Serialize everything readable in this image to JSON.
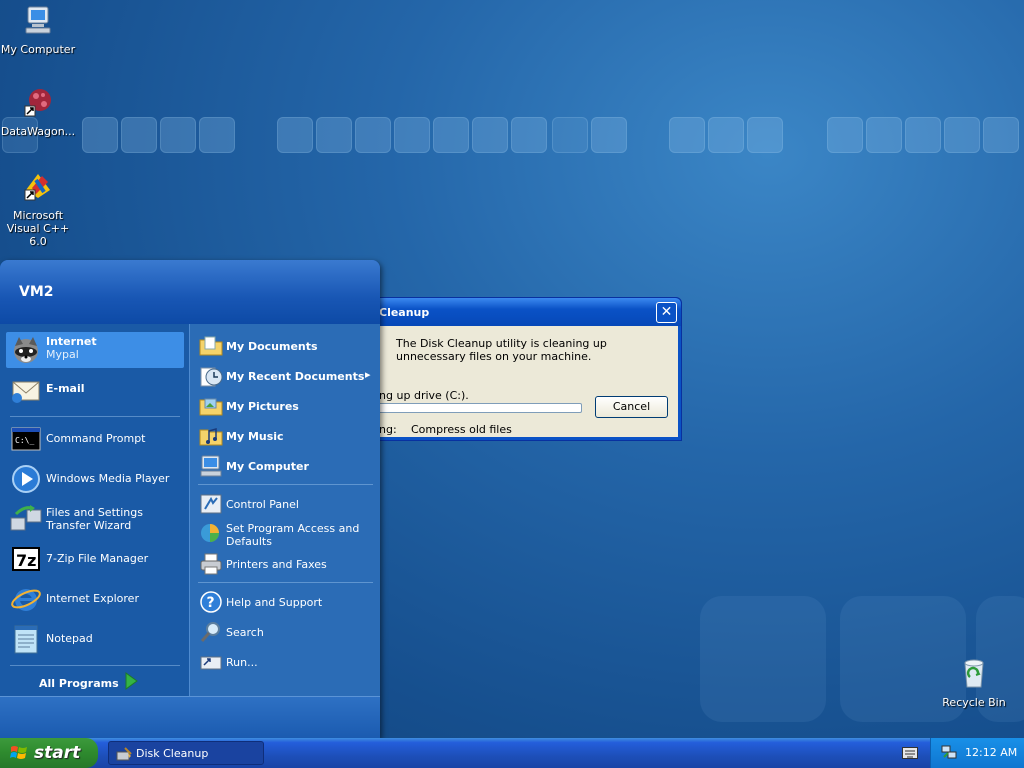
{
  "desktop": {
    "icons": [
      {
        "label": "My Computer"
      },
      {
        "label": "DataWagon..."
      },
      {
        "label": "Microsoft Visual C++ 6.0"
      },
      {
        "label": "Recycle Bin"
      }
    ]
  },
  "dialog": {
    "title": "Cleanup",
    "message": "The Disk Cleanup utility is cleaning up unnecessary files on your machine.",
    "drive_label": "ing up drive  (C:).",
    "progress": 0,
    "current_label": "ing:",
    "current_value": "Compress old files",
    "cancel_label": "Cancel",
    "close_glyph": "✕"
  },
  "start_menu": {
    "user": "VM2",
    "pinned": [
      {
        "label": "Internet",
        "sub": "Mypal"
      },
      {
        "label": "E-mail"
      }
    ],
    "recent": [
      {
        "label": "Command Prompt"
      },
      {
        "label": "Windows Media Player"
      },
      {
        "label": "Files and Settings Transfer Wizard"
      },
      {
        "label": "7-Zip File Manager"
      },
      {
        "label": "Internet Explorer"
      },
      {
        "label": "Notepad"
      }
    ],
    "all_programs": "All Programs",
    "right": [
      {
        "label": "My Documents"
      },
      {
        "label": "My Recent Documents"
      },
      {
        "label": "My Pictures"
      },
      {
        "label": "My Music"
      },
      {
        "label": "My Computer"
      },
      {
        "label": "Control Panel"
      },
      {
        "label": "Set Program Access and Defaults"
      },
      {
        "label": "Printers and Faxes"
      },
      {
        "label": "Help and Support"
      },
      {
        "label": "Search"
      },
      {
        "label": "Run..."
      }
    ],
    "submenu_arrow": "▸"
  },
  "taskbar": {
    "start_label": "start",
    "task_label": "Disk Cleanup",
    "clock": "12:12 AM"
  },
  "colors": {
    "xp_blue": "#0a52c6",
    "start_green": "#2e8a2e",
    "desktop_blue": "#2466a9"
  }
}
